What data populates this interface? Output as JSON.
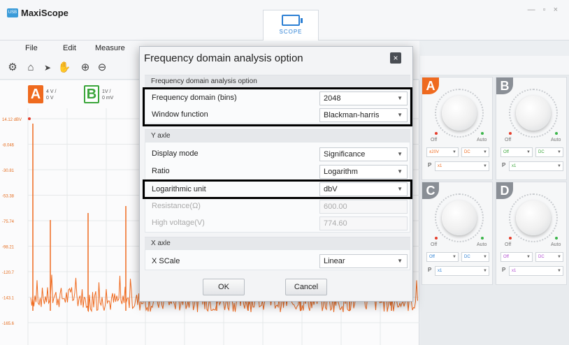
{
  "app": {
    "title": "MaxiScope",
    "logo_text": "USB",
    "window_controls": "— ▫ ×",
    "active_tab": "SCOPE"
  },
  "menu": [
    "File",
    "Edit",
    "Measure"
  ],
  "toolbar_icons": [
    "gear-icon",
    "home-icon",
    "pointer-icon",
    "hand-icon",
    "zoom-in-icon",
    "zoom-out-icon"
  ],
  "channels": {
    "a": {
      "badge": "A",
      "scale": "4 V /",
      "offset": "0 V",
      "color": "#ef6a1f"
    },
    "b": {
      "badge": "B",
      "scale": "1V /",
      "offset": "0 mV",
      "color": "#3aa53a"
    }
  },
  "y_axis_labels": [
    "14.12 dBV",
    "-8.046",
    "-30.81",
    "-53.38",
    "-75.74",
    "-98.21",
    "-120.7",
    "-143.1",
    "-165.6",
    "-188.1"
  ],
  "cards": [
    {
      "badge": "A",
      "color": "#ef6a1f",
      "off": "Off",
      "auto": "Auto",
      "range": "±20V",
      "coupling": "DC",
      "probe_label": "P",
      "probe": "x1",
      "range_color": "#ef6a1f"
    },
    {
      "badge": "B",
      "color": "#8a8f96",
      "off": "Off",
      "auto": "Auto",
      "range": "Off",
      "coupling": "DC",
      "probe_label": "P",
      "probe": "x1",
      "range_color": "#3aa53a"
    },
    {
      "badge": "C",
      "color": "#8a8f96",
      "off": "Off",
      "auto": "Auto",
      "range": "Off",
      "coupling": "DC",
      "probe_label": "P",
      "probe": "x1",
      "range_color": "#2b7fd4"
    },
    {
      "badge": "D",
      "color": "#8a8f96",
      "off": "Off",
      "auto": "Auto",
      "range": "Off",
      "coupling": "DC",
      "probe_label": "P",
      "probe": "x1",
      "range_color": "#b04bd0"
    }
  ],
  "dialog": {
    "title": "Frequency domain analysis option",
    "section1": {
      "header": "Frequency domain analysis option",
      "bins_label": "Frequency domain (bins)",
      "bins_value": "2048",
      "window_label": "Window function",
      "window_value": "Blackman-harris"
    },
    "section2": {
      "header": "Y axle",
      "display_label": "Display mode",
      "display_value": "Significance",
      "ratio_label": "Ratio",
      "ratio_value": "Logarithm",
      "unit_label": "Logarithmic unit",
      "unit_value": "dbV",
      "resistance_label": "Resistance(Ω)",
      "resistance_value": "600.00",
      "hv_label": "High voltage(V)",
      "hv_value": "774.60"
    },
    "section3": {
      "header": "X axle",
      "scale_label": "X SCale",
      "scale_value": "Linear"
    },
    "ok": "OK",
    "cancel": "Cancel"
  }
}
